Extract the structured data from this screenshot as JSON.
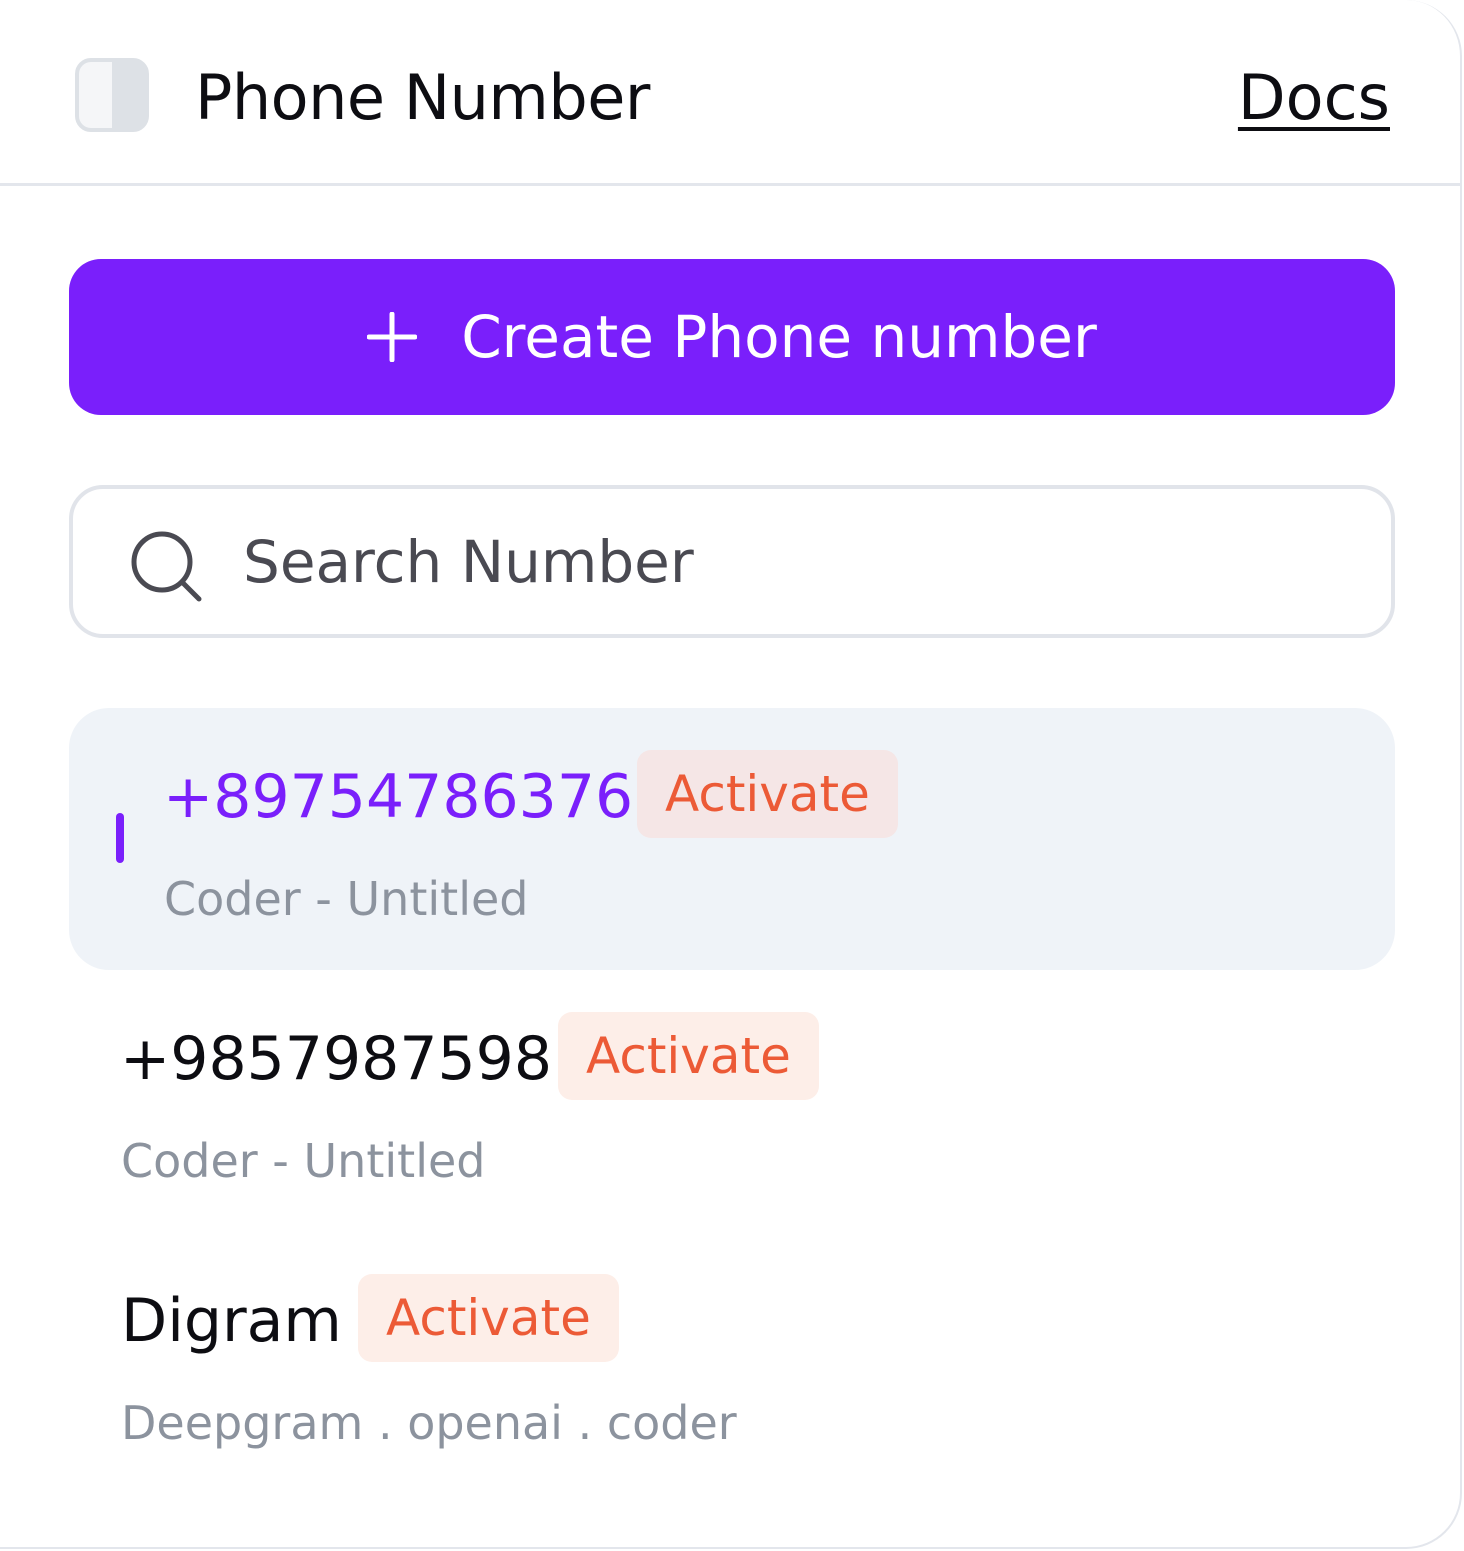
{
  "header": {
    "title": "Phone Number",
    "docs_label": "Docs"
  },
  "create_button": {
    "label": "Create Phone number",
    "icon": "plus-icon"
  },
  "search": {
    "placeholder": "Search Number",
    "value": "",
    "icon": "search-icon"
  },
  "list": {
    "items": [
      {
        "title": "+89754786376",
        "badge": "Activate",
        "subtitle": "Coder - Untitled",
        "selected": true
      },
      {
        "title": "+9857987598",
        "badge": "Activate",
        "subtitle": "Coder - Untitled",
        "selected": false
      },
      {
        "title": "Digram",
        "badge": "Activate",
        "subtitle": "Deepgram . openai . coder",
        "selected": false
      }
    ]
  },
  "colors": {
    "accent": "#7a1ffb",
    "badge_text": "#ec5a36",
    "badge_bg": "#fdeee8",
    "selected_bg": "#eff3f8",
    "subtitle": "#8c939e"
  }
}
